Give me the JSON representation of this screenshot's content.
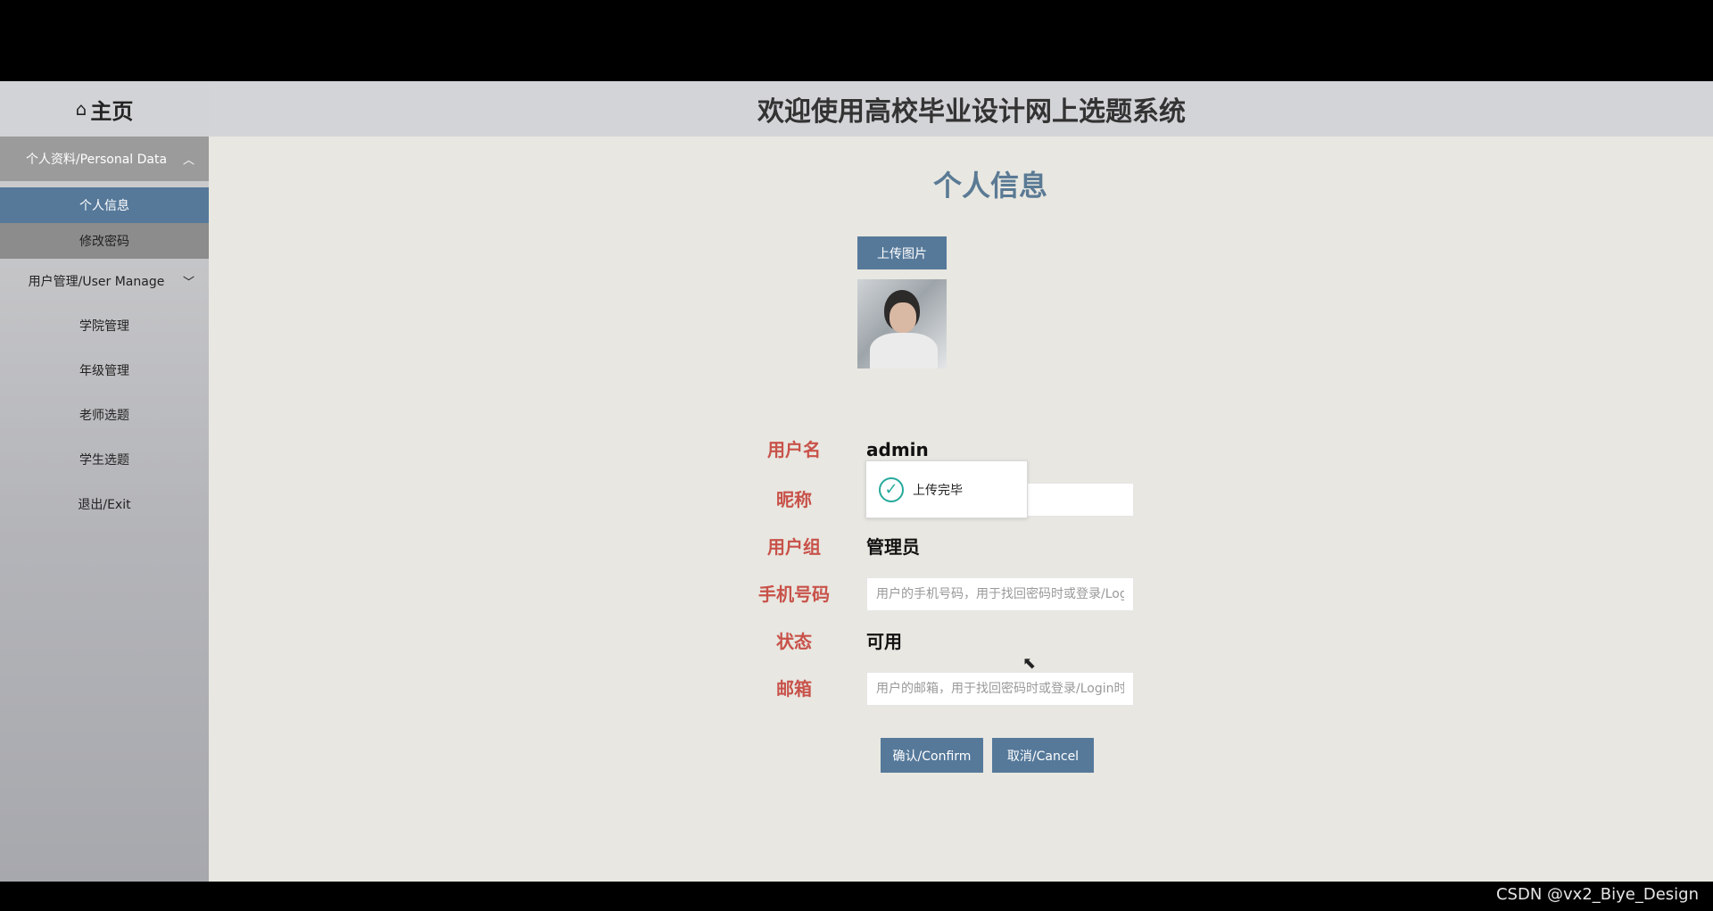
{
  "sidebar": {
    "home_label": "主页",
    "menu1": {
      "label": "个人资料/Personal Data",
      "items": [
        "个人信息",
        "修改密码"
      ]
    },
    "menu2": {
      "label": "用户管理/User Manage"
    },
    "items": [
      "学院管理",
      "年级管理",
      "老师选题",
      "学生选题",
      "退出/Exit"
    ]
  },
  "header": {
    "title": "欢迎使用高校毕业设计网上选题系统"
  },
  "page": {
    "title": "个人信息",
    "upload_button": "上传图片"
  },
  "form": {
    "username": {
      "label": "用户名",
      "value": "admin"
    },
    "nickname": {
      "label": "昵称",
      "value": ""
    },
    "group": {
      "label": "用户组",
      "value": "管理员"
    },
    "phone": {
      "label": "手机号码",
      "placeholder": "用户的手机号码，用于找回密码时或登录/Login时"
    },
    "status": {
      "label": "状态",
      "value": "可用"
    },
    "email": {
      "label": "邮箱",
      "placeholder": "用户的邮箱，用于找回密码时或登录/Login时"
    }
  },
  "toast": {
    "message": "上传完毕"
  },
  "buttons": {
    "confirm": "确认/Confirm",
    "cancel": "取消/Cancel"
  },
  "watermark": "CSDN @vx2_Biye_Design",
  "colors": {
    "accent": "#56799a",
    "label_red": "#c8524a",
    "success": "#27a99c"
  }
}
